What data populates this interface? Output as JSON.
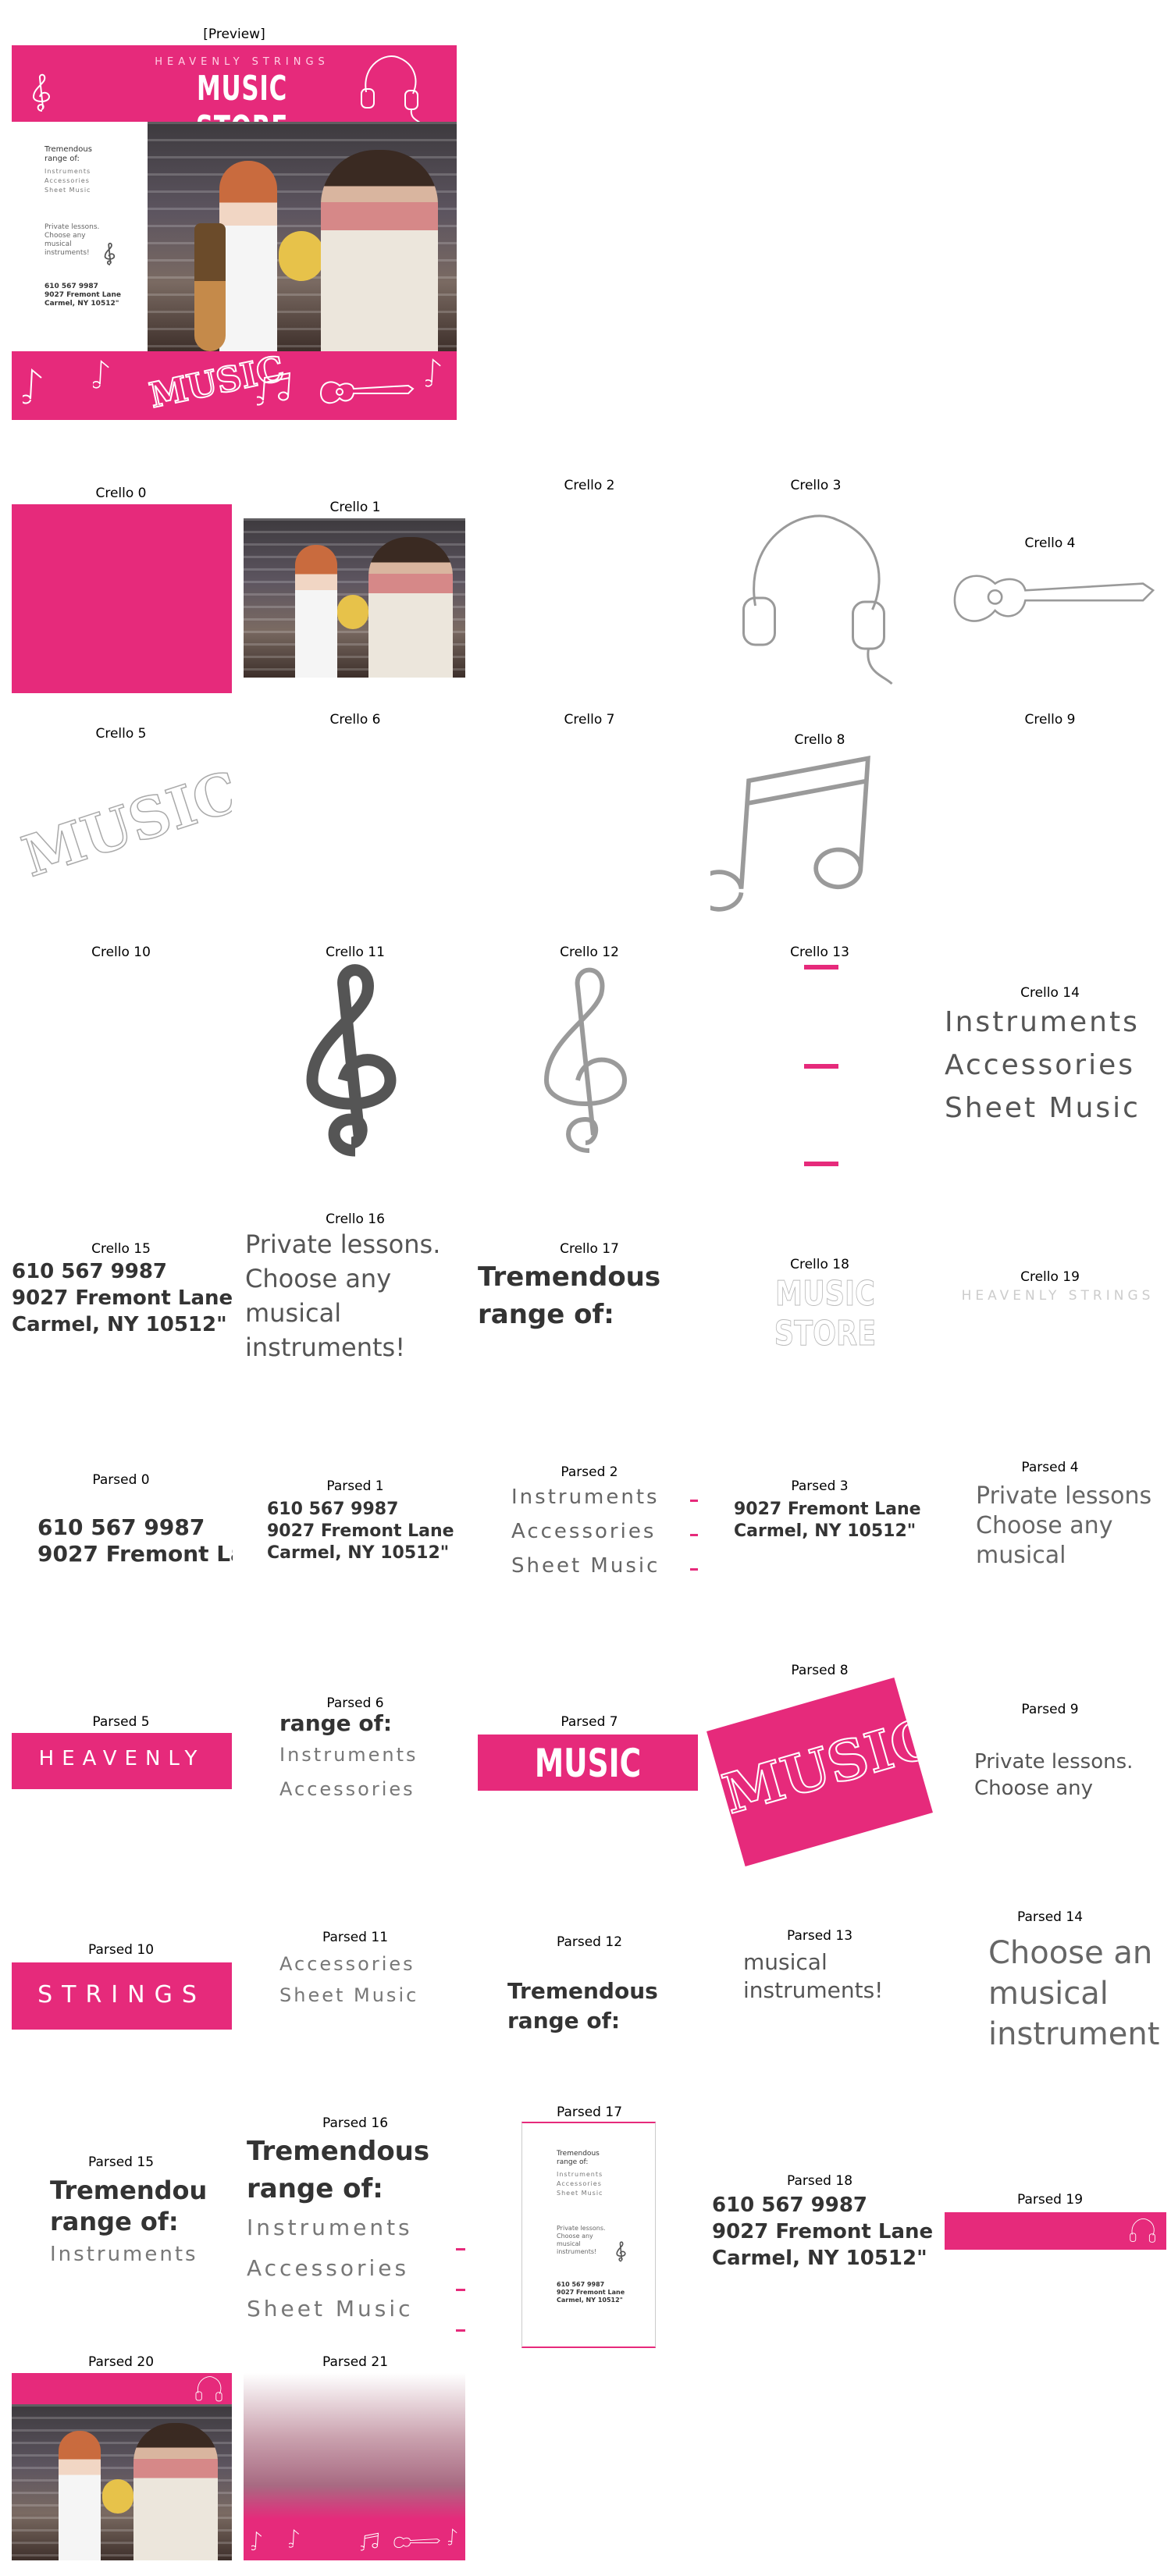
{
  "preview": {
    "caption": "[Preview]",
    "brand_top": "HEAVENLY STRINGS",
    "title": "MUSIC STORE",
    "range_heading": "Tremendous range of:",
    "range_items": [
      "Instruments",
      "Accessories",
      "Sheet Music"
    ],
    "lessons": "Private lessons. Choose any musical instruments!",
    "phone": "610 567 9987",
    "address1": "9027 Fremont Lane",
    "address2": "Carmel, NY 10512\"",
    "word_art": "MUSIC"
  },
  "crello": {
    "captions": [
      "Crello 0",
      "Crello 1",
      "Crello 2",
      "Crello 3",
      "Crello 4",
      "Crello 5",
      "Crello 6",
      "Crello 7",
      "Crello 8",
      "Crello 9",
      "Crello 10",
      "Crello 11",
      "Crello 12",
      "Crello 13",
      "Crello 14",
      "Crello 15",
      "Crello 16",
      "Crello 17",
      "Crello 18",
      "Crello 19"
    ],
    "c14": [
      "Instruments",
      "Accessories",
      "Sheet Music"
    ],
    "c15": [
      "610 567 9987",
      "9027 Fremont Lane",
      "Carmel, NY 10512\""
    ],
    "c16": [
      "Private lessons.",
      "Choose any",
      "musical",
      "instruments!"
    ],
    "c17": [
      "Tremendous",
      "range of:"
    ],
    "c18": "MUSIC STORE",
    "c19": "HEAVENLY STRINGS"
  },
  "parsed": {
    "captions": [
      "Parsed 0",
      "Parsed 1",
      "Parsed 2",
      "Parsed 3",
      "Parsed 4",
      "Parsed 5",
      "Parsed 6",
      "Parsed 7",
      "Parsed 8",
      "Parsed 9",
      "Parsed 10",
      "Parsed 11",
      "Parsed 12",
      "Parsed 13",
      "Parsed 14",
      "Parsed 15",
      "Parsed 16",
      "Parsed 17",
      "Parsed 18",
      "Parsed 19",
      "Parsed 20",
      "Parsed 21"
    ],
    "p0": [
      "610 567 9987",
      "9027 Fremont La"
    ],
    "p1": [
      "610 567 9987",
      "9027 Fremont Lane",
      "Carmel, NY 10512\""
    ],
    "p2": [
      "Instruments",
      "Accessories",
      "Sheet Music"
    ],
    "p3": [
      "9027 Fremont Lane",
      "Carmel, NY 10512\""
    ],
    "p4": [
      "Private lessons",
      "Choose any",
      "musical"
    ],
    "p5": "HEAVENLY",
    "p6": [
      "range of:",
      "Instruments",
      "Accessories"
    ],
    "p7": "MUSIC STORE",
    "p8": "MUSIC",
    "p9": [
      "Private lessons.",
      "Choose any"
    ],
    "p10": "STRINGS",
    "p11": [
      "Accessories",
      "Sheet Music"
    ],
    "p12": [
      "Tremendous",
      "range of:"
    ],
    "p13": [
      "musical",
      "instruments!"
    ],
    "p14": [
      "Choose an",
      "musical",
      "instrument"
    ],
    "p15": [
      "Tremendou",
      "range of:",
      "Instruments"
    ],
    "p16": [
      "Tremendous",
      "range of:",
      "Instruments",
      "Accessories",
      "Sheet Music"
    ],
    "p18": [
      "610 567 9987",
      "9027 Fremont Lane",
      "Carmel, NY 10512\""
    ]
  },
  "colors": {
    "accent": "#e62a7b",
    "text_gray": "#555555"
  },
  "icons": [
    "headphones-icon",
    "treble-clef-icon",
    "music-note-icon",
    "guitar-icon"
  ]
}
